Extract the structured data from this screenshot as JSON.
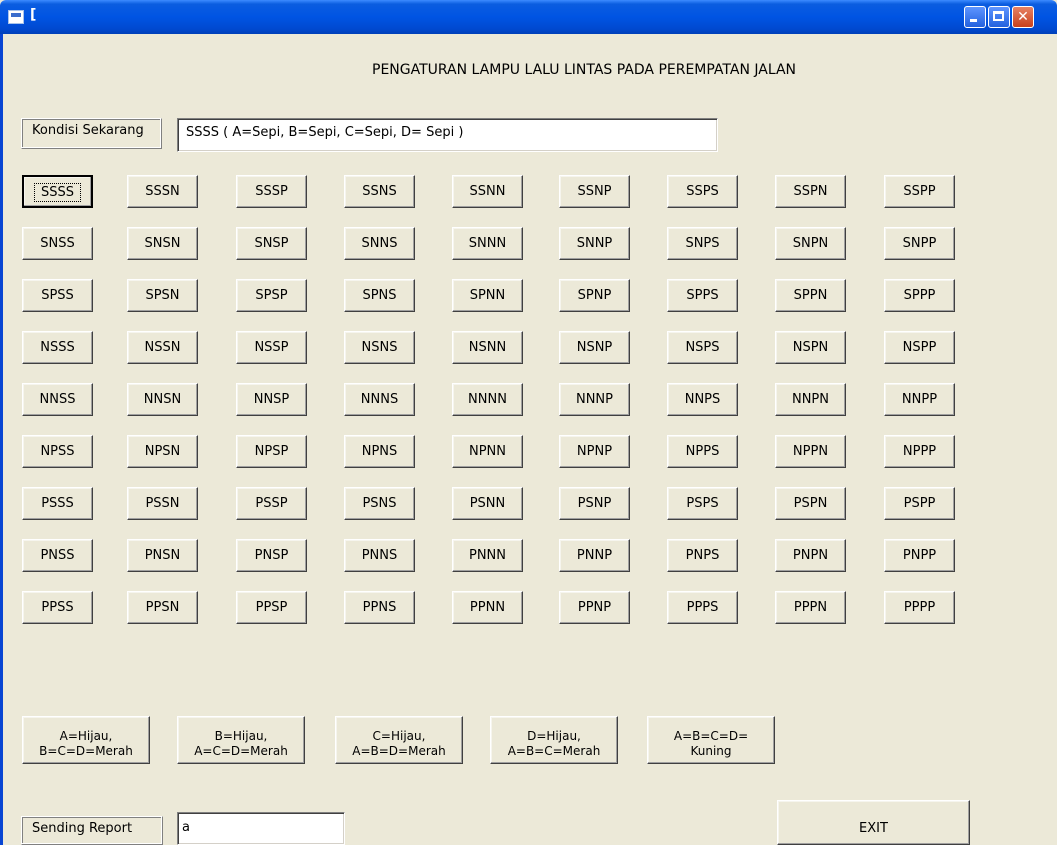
{
  "window": {
    "title": "["
  },
  "page_title": "PENGATURAN LAMPU LALU LINTAS PADA PEREMPATAN JALAN",
  "kondisi": {
    "label": "Kondisi Sekarang",
    "value": "SSSS   ( A=Sepi, B=Sepi, C=Sepi, D= Sepi )"
  },
  "grid": [
    [
      "SSSS",
      "SSSN",
      "SSSP",
      "SSNS",
      "SSNN",
      "SSNP",
      "SSPS",
      "SSPN",
      "SSPP"
    ],
    [
      "SNSS",
      "SNSN",
      "SNSP",
      "SNNS",
      "SNNN",
      "SNNP",
      "SNPS",
      "SNPN",
      "SNPP"
    ],
    [
      "SPSS",
      "SPSN",
      "SPSP",
      "SPNS",
      "SPNN",
      "SPNP",
      "SPPS",
      "SPPN",
      "SPPP"
    ],
    [
      "NSSS",
      "NSSN",
      "NSSP",
      "NSNS",
      "NSNN",
      "NSNP",
      "NSPS",
      "NSPN",
      "NSPP"
    ],
    [
      "NNSS",
      "NNSN",
      "NNSP",
      "NNNS",
      "NNNN",
      "NNNP",
      "NNPS",
      "NNPN",
      "NNPP"
    ],
    [
      "NPSS",
      "NPSN",
      "NPSP",
      "NPNS",
      "NPNN",
      "NPNP",
      "NPPS",
      "NPPN",
      "NPPP"
    ],
    [
      "PSSS",
      "PSSN",
      "PSSP",
      "PSNS",
      "PSNN",
      "PSNP",
      "PSPS",
      "PSPN",
      "PSPP"
    ],
    [
      "PNSS",
      "PNSN",
      "PNSP",
      "PNNS",
      "PNNN",
      "PNNP",
      "PNPS",
      "PNPN",
      "PNPP"
    ],
    [
      "PPSS",
      "PPSN",
      "PPSP",
      "PPNS",
      "PPNN",
      "PPNP",
      "PPPS",
      "PPPN",
      "PPPP"
    ]
  ],
  "focused_button": "SSSS",
  "light_buttons": [
    {
      "line1": "A=Hijau,",
      "line2": "B=C=D=Merah"
    },
    {
      "line1": "B=Hijau,",
      "line2": "A=C=D=Merah"
    },
    {
      "line1": "C=Hijau,",
      "line2": "A=B=D=Merah"
    },
    {
      "line1": "D=Hijau,",
      "line2": "A=B=C=Merah"
    },
    {
      "line1": "A=B=C=D=",
      "line2": "Kuning"
    }
  ],
  "report": {
    "label": "Sending Report",
    "value": "a"
  },
  "exit_label": "EXIT"
}
